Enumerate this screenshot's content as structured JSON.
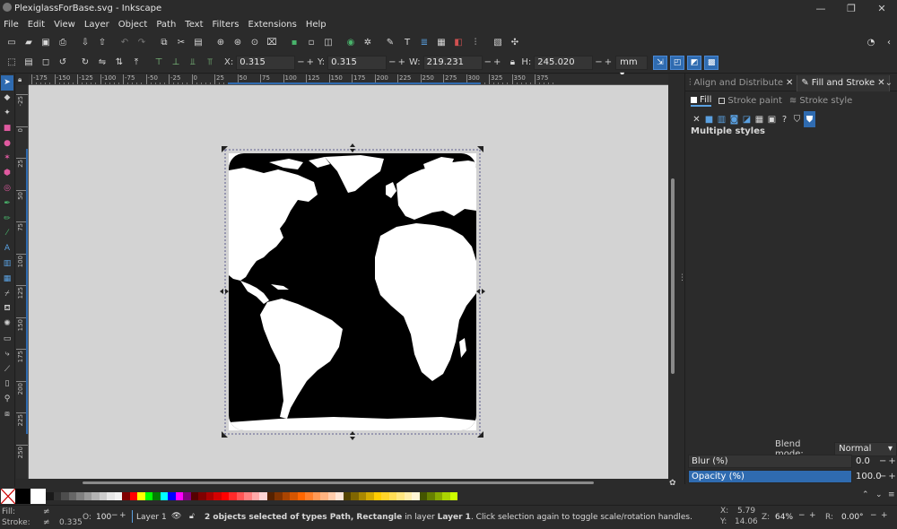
{
  "window": {
    "title": "PlexiglassForBase.svg - Inkscape"
  },
  "menu": [
    "File",
    "Edit",
    "View",
    "Layer",
    "Object",
    "Path",
    "Text",
    "Filters",
    "Extensions",
    "Help"
  ],
  "controls": {
    "x_label": "X:",
    "x_value": "0.315",
    "y_label": "Y:",
    "y_value": "0.315",
    "w_label": "W:",
    "w_value": "219.231",
    "h_label": "H:",
    "h_value": "245.020",
    "unit": "mm",
    "minus": "−",
    "plus": "+"
  },
  "ruler": {
    "h_ticks": [
      "-175",
      "-150",
      "-125",
      "-100",
      "-75",
      "-50",
      "-25",
      "0",
      "25",
      "50",
      "75",
      "100",
      "125",
      "150",
      "175",
      "200",
      "225",
      "250",
      "275",
      "300",
      "325",
      "350",
      "375"
    ],
    "v_ticks": [
      "-25",
      "0",
      "25",
      "50",
      "75",
      "100",
      "125",
      "150",
      "175",
      "200",
      "225",
      "250"
    ]
  },
  "dock": {
    "tabs": [
      {
        "label": "Align and Distribute"
      },
      {
        "label": "Fill and Stroke"
      }
    ],
    "subtabs": [
      {
        "label": "Fill"
      },
      {
        "label": "Stroke paint"
      },
      {
        "label": "Stroke style"
      }
    ],
    "fill_status": "Multiple styles",
    "blend_label": "Blend mode:",
    "blend_value": "Normal",
    "blur_label": "Blur (%)",
    "blur_value": "0.0",
    "opacity_label": "Opacity (%)",
    "opacity_value": "100.0",
    "opacity_fraction": 1.0
  },
  "status": {
    "fill_label": "Fill:",
    "fill_value": "≠",
    "stroke_label": "Stroke:",
    "stroke_value": "≠",
    "stroke_width": "0.335",
    "o_label": "O:",
    "o_value": "100",
    "layer_name": "Layer 1",
    "message_bold": "2 objects selected of types Path, Rectangle",
    "message_mid": " in layer ",
    "message_layer": "Layer 1",
    "message_tail": ". Click selection again to toggle scale/rotation handles.",
    "x_label": "X:",
    "x_value": "5.79",
    "y_label": "Y:",
    "y_value": "14.06",
    "z_label": "Z:",
    "zoom_value": "64%",
    "r_label": "R:",
    "rotation_value": "0.00°"
  },
  "palette_colors": [
    "#000000",
    "#ffffff",
    "#1a1a1a",
    "#333333",
    "#4d4d4d",
    "#666666",
    "#808080",
    "#999999",
    "#b3b3b3",
    "#cccccc",
    "#e6e6e6",
    "#f2f2f2",
    "#800000",
    "#ff0000",
    "#ffff00",
    "#00ff00",
    "#008000",
    "#00ffff",
    "#0000ff",
    "#ff00ff",
    "#800080",
    "#550000",
    "#800000",
    "#aa0000",
    "#d40000",
    "#ff0000",
    "#ff2a2a",
    "#ff5555",
    "#ff8080",
    "#ffaaaa",
    "#ffd5d5",
    "#552200",
    "#803300",
    "#aa4400",
    "#d45500",
    "#ff6600",
    "#ff7f2a",
    "#ff9955",
    "#ffb380",
    "#ffccaa",
    "#ffe6d5",
    "#554400",
    "#806600",
    "#aa8800",
    "#d4aa00",
    "#ffcc00",
    "#ffd42a",
    "#ffdd55",
    "#ffe680",
    "#ffeeaa",
    "#fff6d5",
    "#445500",
    "#668000",
    "#88aa00",
    "#aad400",
    "#ccff00"
  ],
  "colors": {
    "accent": "#2f6bb0",
    "canvas_bg": "#d3d3d3",
    "ui_bg": "#2b2b2b"
  }
}
